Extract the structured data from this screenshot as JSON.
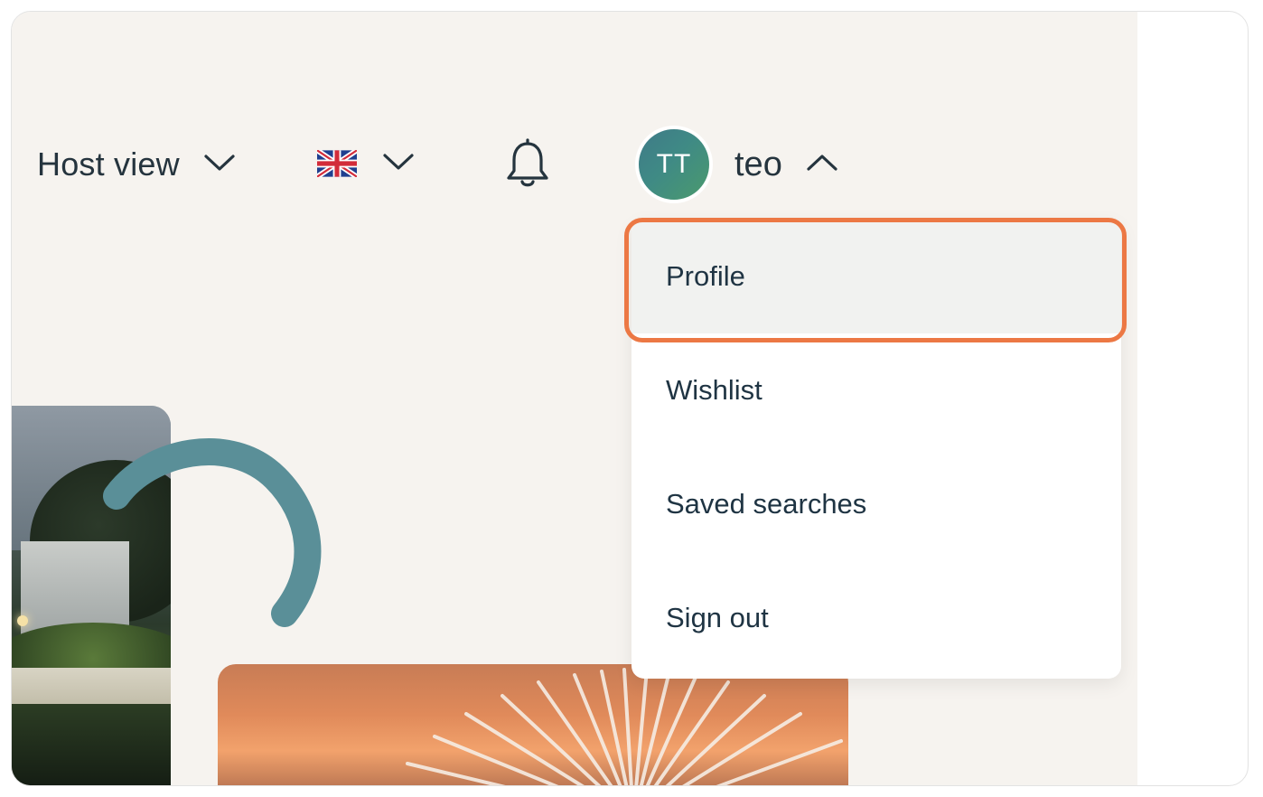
{
  "header": {
    "host_view_label": "Host view",
    "language": {
      "flag_icon": "uk-flag-icon",
      "dropdown_icon": "chevron-down-icon"
    },
    "notifications_icon": "bell-icon",
    "user": {
      "initials": "TT",
      "name": "teo",
      "dropdown_icon": "chevron-up-icon",
      "avatar_gradient": [
        "#3f7a88",
        "#4b9a6d"
      ]
    }
  },
  "user_menu": {
    "items": [
      {
        "label": "Profile",
        "active": true
      },
      {
        "label": "Wishlist",
        "active": false
      },
      {
        "label": "Saved searches",
        "active": false
      },
      {
        "label": "Sign out",
        "active": false
      }
    ],
    "highlight_color": "#ec7844"
  },
  "colors": {
    "page_background": "#f6f3ef",
    "text": "#25343e",
    "accent_arc": "#5a8f98"
  }
}
